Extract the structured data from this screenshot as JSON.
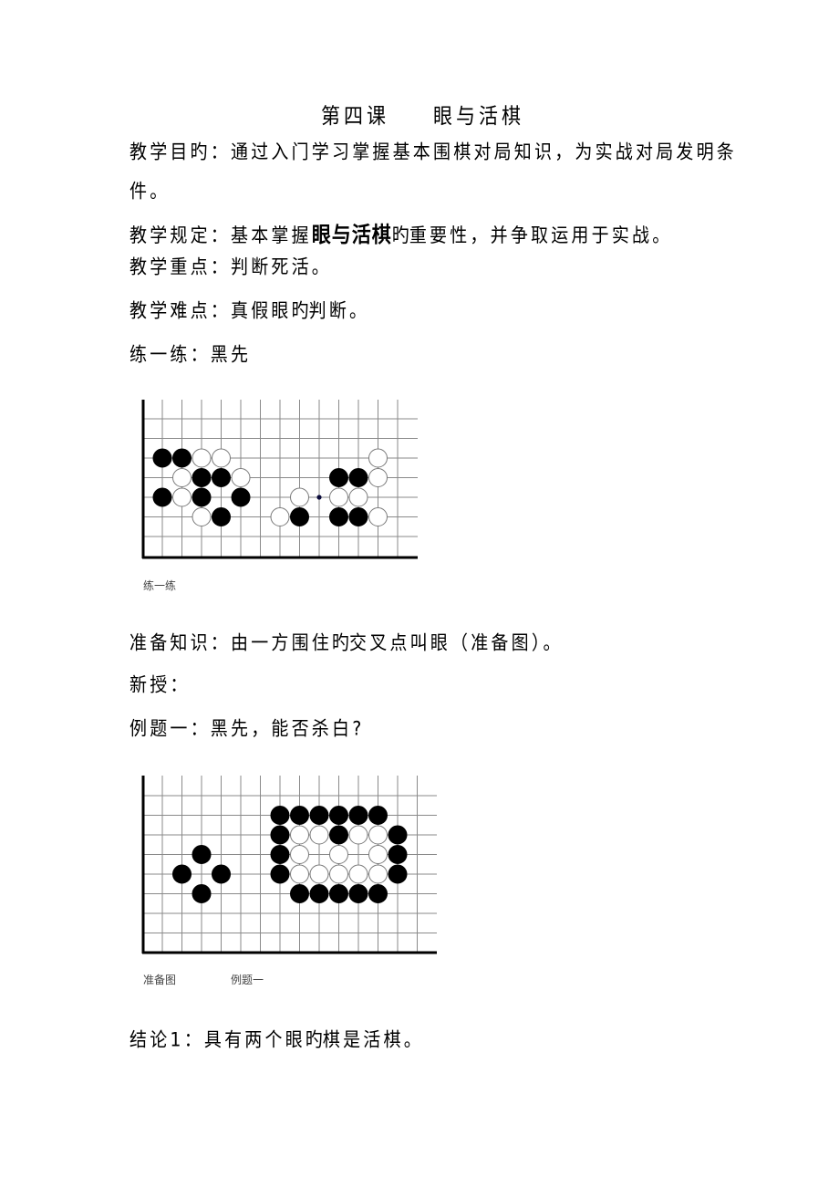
{
  "document": {
    "title_part1": "第四课",
    "title_part2": "眼与活棋",
    "objective_line1": "教学目旳：通过入门学习掌握基本围棋对局知识，为实战对局发明条",
    "objective_line2": "件。",
    "requirement": {
      "prefix": "教学规定：基本掌握",
      "emphasis": "眼与活棋",
      "suffix_light": "旳",
      "suffix": "重要性，并争取运用于实战。"
    },
    "key_point": "教学重点：判断死活。",
    "difficulty": {
      "prefix": "教学难点：真假眼",
      "light": "旳",
      "suffix": "判断。"
    },
    "practice_heading": "练一练：黑先",
    "practice_caption": "练一练",
    "prep_knowledge": {
      "prefix": "准备知识：由一方围住",
      "light": "旳",
      "suffix": "交叉点叫眼（准备图）。"
    },
    "new_lesson": "新授：",
    "example_heading": "例题一：黑先，能否杀白?",
    "example_captions": [
      "准备图",
      "例题一"
    ],
    "conclusion": {
      "prefix": "结论1：具有两个眼",
      "light": "旳",
      "suffix": "棋是活棋。"
    }
  },
  "boards": [
    {
      "name": "practice-board",
      "columns": 13,
      "rows": 7,
      "stones": [
        {
          "color": "black",
          "col": 0,
          "row": 2
        },
        {
          "color": "black",
          "col": 1,
          "row": 2
        },
        {
          "color": "white",
          "col": 2,
          "row": 2
        },
        {
          "color": "white",
          "col": 3,
          "row": 2
        },
        {
          "color": "white",
          "col": 11,
          "row": 2
        },
        {
          "color": "white",
          "col": 1,
          "row": 3
        },
        {
          "color": "black",
          "col": 2,
          "row": 3
        },
        {
          "color": "black",
          "col": 3,
          "row": 3
        },
        {
          "color": "white",
          "col": 4,
          "row": 3
        },
        {
          "color": "black",
          "col": 9,
          "row": 3
        },
        {
          "color": "black",
          "col": 10,
          "row": 3
        },
        {
          "color": "white",
          "col": 11,
          "row": 3
        },
        {
          "color": "black",
          "col": 0,
          "row": 4
        },
        {
          "color": "white",
          "col": 1,
          "row": 4
        },
        {
          "color": "black",
          "col": 2,
          "row": 4
        },
        {
          "color": "black",
          "col": 4,
          "row": 4
        },
        {
          "color": "white",
          "col": 7,
          "row": 4
        },
        {
          "color": "white",
          "col": 9,
          "row": 4
        },
        {
          "color": "white",
          "col": 10,
          "row": 4
        },
        {
          "color": "white",
          "col": 2,
          "row": 5
        },
        {
          "color": "black",
          "col": 3,
          "row": 5
        },
        {
          "color": "white",
          "col": 6,
          "row": 5
        },
        {
          "color": "black",
          "col": 7,
          "row": 5
        },
        {
          "color": "black",
          "col": 9,
          "row": 5
        },
        {
          "color": "black",
          "col": 10,
          "row": 5
        },
        {
          "color": "white",
          "col": 11,
          "row": 5
        }
      ],
      "markers": [
        {
          "type": "dot",
          "col": 8,
          "row": 4
        }
      ]
    },
    {
      "name": "example-board",
      "columns": 14,
      "rows": 8,
      "stones": [
        {
          "color": "black",
          "col": 6,
          "row": 1
        },
        {
          "color": "black",
          "col": 7,
          "row": 1
        },
        {
          "color": "black",
          "col": 8,
          "row": 1
        },
        {
          "color": "black",
          "col": 9,
          "row": 1
        },
        {
          "color": "black",
          "col": 10,
          "row": 1
        },
        {
          "color": "black",
          "col": 11,
          "row": 1
        },
        {
          "color": "black",
          "col": 6,
          "row": 2
        },
        {
          "color": "white",
          "col": 7,
          "row": 2
        },
        {
          "color": "white",
          "col": 8,
          "row": 2
        },
        {
          "color": "black",
          "col": 9,
          "row": 2
        },
        {
          "color": "white",
          "col": 10,
          "row": 2
        },
        {
          "color": "white",
          "col": 11,
          "row": 2
        },
        {
          "color": "black",
          "col": 12,
          "row": 2
        },
        {
          "color": "black",
          "col": 2,
          "row": 3
        },
        {
          "color": "black",
          "col": 6,
          "row": 3
        },
        {
          "color": "white",
          "col": 7,
          "row": 3
        },
        {
          "color": "white",
          "col": 9,
          "row": 3
        },
        {
          "color": "white",
          "col": 11,
          "row": 3
        },
        {
          "color": "black",
          "col": 12,
          "row": 3
        },
        {
          "color": "black",
          "col": 1,
          "row": 4
        },
        {
          "color": "black",
          "col": 3,
          "row": 4
        },
        {
          "color": "black",
          "col": 6,
          "row": 4
        },
        {
          "color": "white",
          "col": 7,
          "row": 4
        },
        {
          "color": "white",
          "col": 8,
          "row": 4
        },
        {
          "color": "white",
          "col": 9,
          "row": 4
        },
        {
          "color": "white",
          "col": 10,
          "row": 4
        },
        {
          "color": "white",
          "col": 11,
          "row": 4
        },
        {
          "color": "black",
          "col": 12,
          "row": 4
        },
        {
          "color": "black",
          "col": 2,
          "row": 5
        },
        {
          "color": "black",
          "col": 7,
          "row": 5
        },
        {
          "color": "black",
          "col": 8,
          "row": 5
        },
        {
          "color": "black",
          "col": 9,
          "row": 5
        },
        {
          "color": "black",
          "col": 10,
          "row": 5
        },
        {
          "color": "black",
          "col": 11,
          "row": 5
        }
      ],
      "markers": []
    }
  ],
  "colors": {
    "text": "#000000",
    "grid": "#8a8a8a",
    "border": "#000000",
    "stone_black": "#000000",
    "stone_white": "#ffffff",
    "stone_outline": "#7a7a7a",
    "marker": "#0a0a3a",
    "caption": "#444444"
  }
}
